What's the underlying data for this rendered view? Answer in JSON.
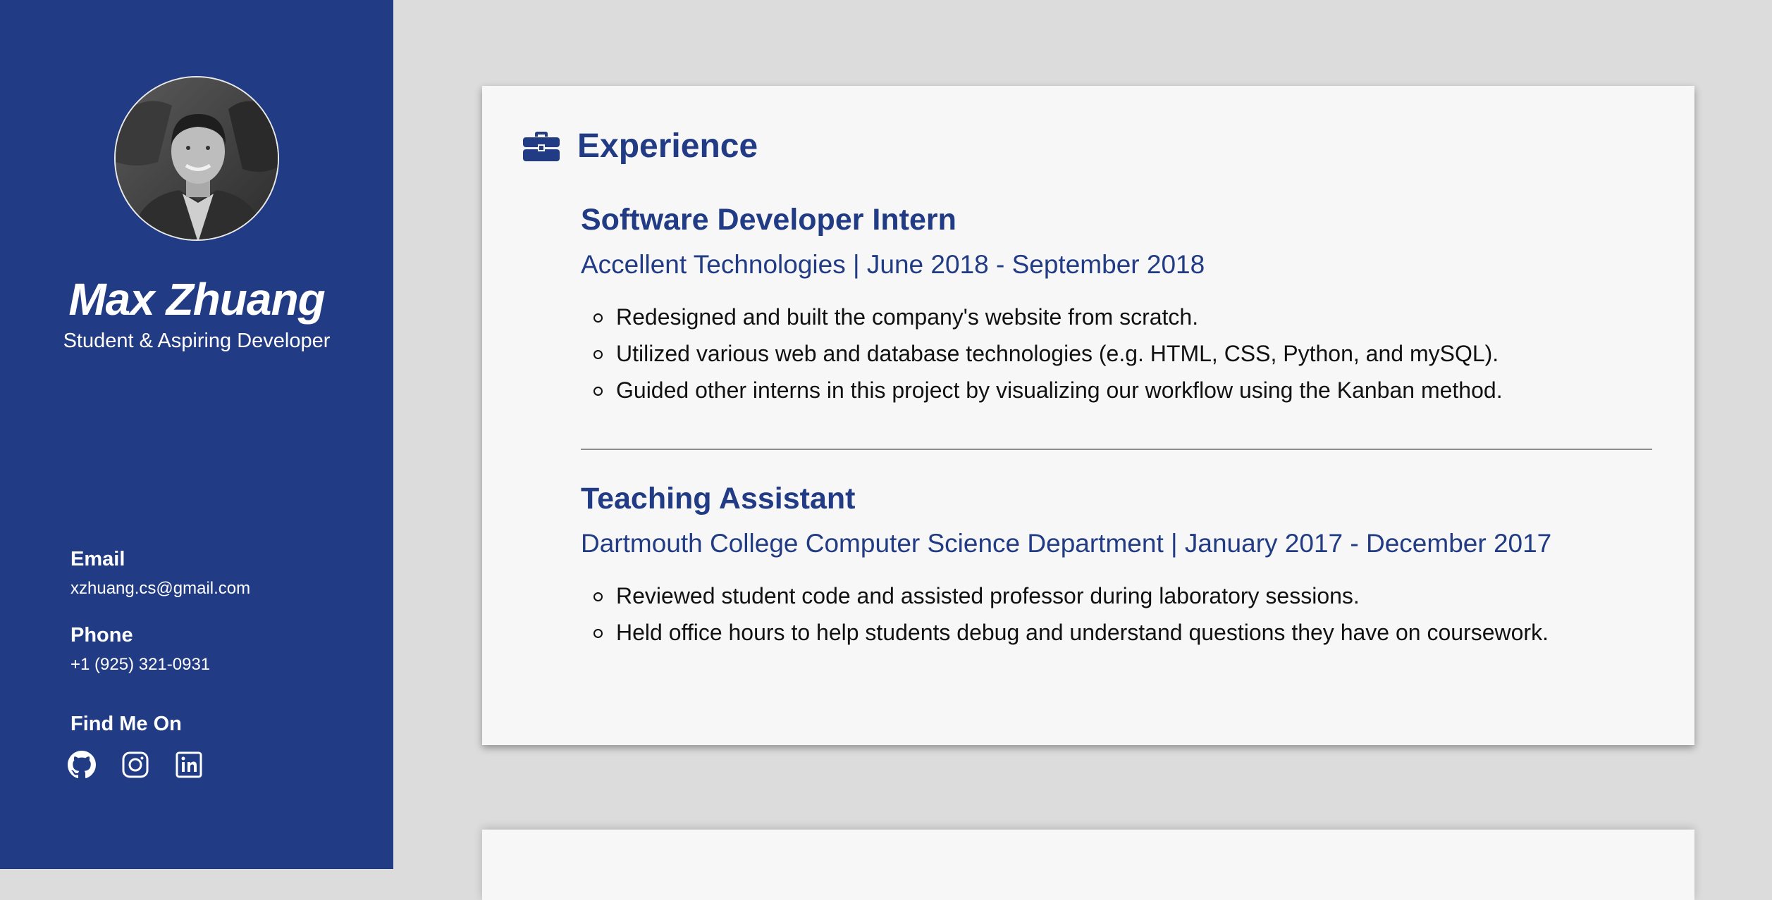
{
  "colors": {
    "accent": "#213b85",
    "sidebar_bg": "#213b85",
    "page_bg": "#dcdcdc",
    "card_bg": "#f7f7f7"
  },
  "profile": {
    "name": "Max Zhuang",
    "tagline": "Student & Aspiring Developer"
  },
  "contact": {
    "email_label": "Email",
    "email": "xzhuang.cs@gmail.com",
    "phone_label": "Phone",
    "phone": "+1 (925) 321-0931",
    "social_label": "Find Me On",
    "social_icons": [
      "github-icon",
      "instagram-icon",
      "linkedin-icon"
    ]
  },
  "experience": {
    "title": "Experience",
    "icon": "briefcase-icon",
    "jobs": [
      {
        "title": "Software Developer Intern",
        "subtitle": "Accellent Technologies | June 2018 - September 2018",
        "bullets": [
          "Redesigned and built the company's website from scratch.",
          "Utilized various web and database technologies (e.g. HTML, CSS, Python, and mySQL).",
          "Guided other interns in this project by visualizing our workflow using the Kanban method."
        ]
      },
      {
        "title": "Teaching Assistant",
        "subtitle": "Dartmouth College Computer Science Department | January 2017 - December 2017",
        "bullets": [
          "Reviewed student code and assisted professor during laboratory sessions.",
          "Held office hours to help students debug and understand questions they have on coursework."
        ]
      }
    ]
  }
}
